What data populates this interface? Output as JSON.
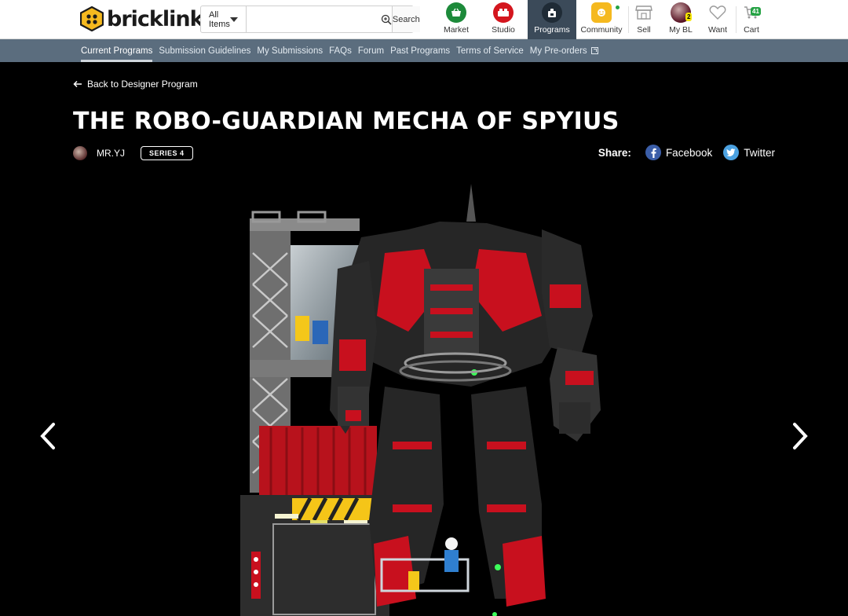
{
  "brand": {
    "name": "bricklink",
    "reg": "®"
  },
  "search": {
    "category": "All Items",
    "placeholder": "",
    "button": "Search"
  },
  "nav": [
    {
      "label": "Market"
    },
    {
      "label": "Studio"
    },
    {
      "label": "Programs"
    },
    {
      "label": "Community"
    },
    {
      "label": "Sell"
    },
    {
      "label": "My BL",
      "badge": "2"
    },
    {
      "label": "Want"
    },
    {
      "label": "Cart",
      "badge": "41"
    }
  ],
  "subnav": [
    "Current Programs",
    "Submission Guidelines",
    "My Submissions",
    "FAQs",
    "Forum",
    "Past Programs",
    "Terms of Service",
    "My Pre-orders"
  ],
  "page": {
    "back": "Back to Designer Program",
    "title": "THE ROBO-GUARDIAN MECHA OF SPYIUS",
    "author": "MR.YJ",
    "series": "SERIES 4",
    "share_label": "Share:",
    "facebook": "Facebook",
    "twitter": "Twitter"
  },
  "colors": {
    "topbar": "#ffffff",
    "subnav": "#5b6d7e",
    "active_nav": "#3b4a59",
    "mecha_red": "#c8101e"
  }
}
